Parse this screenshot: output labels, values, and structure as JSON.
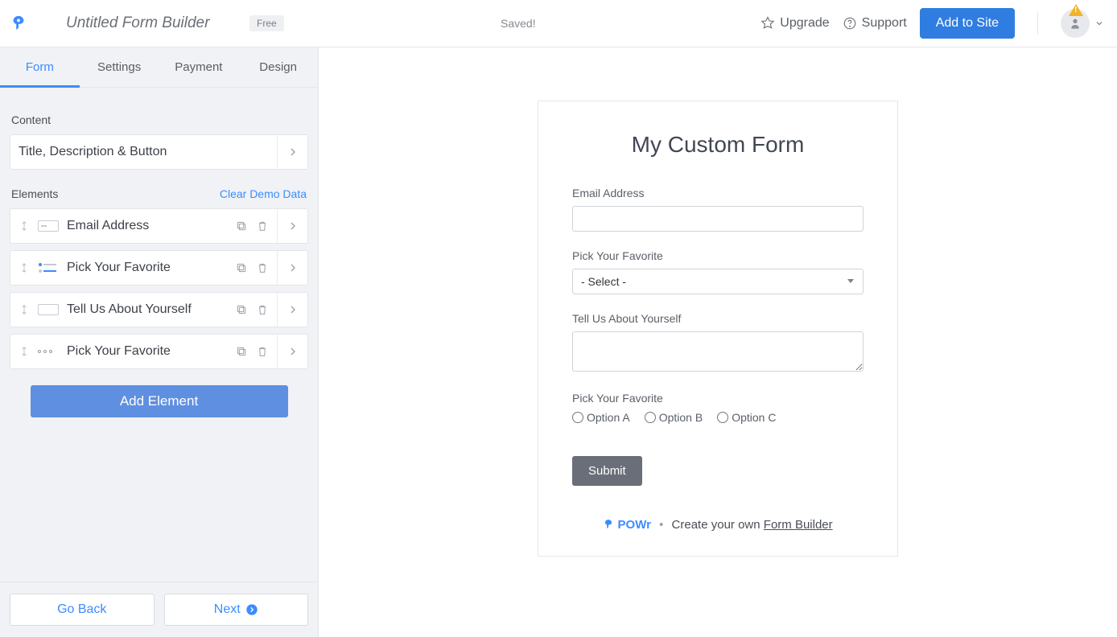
{
  "header": {
    "title_value": "Untitled Form Builder",
    "badge": "Free",
    "saved": "Saved!",
    "upgrade": "Upgrade",
    "support": "Support",
    "add_to_site": "Add to Site"
  },
  "sidebar": {
    "tabs": [
      "Form",
      "Settings",
      "Payment",
      "Design"
    ],
    "content_label": "Content",
    "title_card": "Title, Description & Button",
    "elements_label": "Elements",
    "clear_demo": "Clear Demo Data",
    "elements": [
      {
        "label": "Email Address"
      },
      {
        "label": "Pick Your Favorite"
      },
      {
        "label": "Tell Us About Yourself"
      },
      {
        "label": "Pick Your Favorite"
      }
    ],
    "add_element": "Add Element",
    "go_back": "Go Back",
    "next": "Next"
  },
  "form": {
    "title": "My Custom Form",
    "fields": {
      "email_label": "Email Address",
      "select_label": "Pick Your Favorite",
      "select_placeholder": "- Select -",
      "textarea_label": "Tell Us About Yourself",
      "radio_label": "Pick Your Favorite",
      "radio_options": [
        "Option A",
        "Option B",
        "Option C"
      ]
    },
    "submit": "Submit",
    "credit_brand": "POWr",
    "credit_text": "Create your own ",
    "credit_link": "Form Builder"
  }
}
